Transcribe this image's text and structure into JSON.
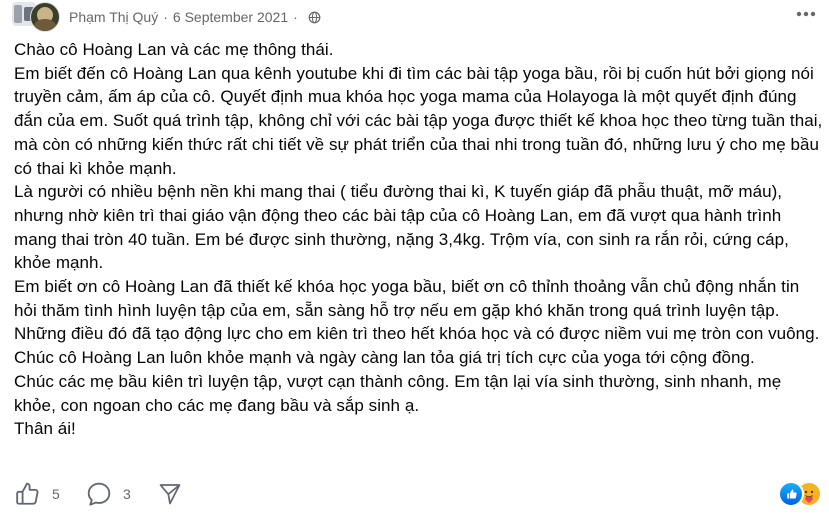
{
  "post": {
    "author": "Phạm Thị Quý",
    "separator": "·",
    "date": "6 September 2021",
    "privacy_icon": "globe-icon",
    "more_icon": "more-horizontal-icon",
    "body": [
      "Chào cô Hoàng Lan và các mẹ thông thái.",
      "Em biết đến cô Hoàng Lan qua kênh youtube khi đi tìm các bài tập yoga bầu, rồi bị cuốn hút bởi giọng nói truyền cảm, ấm áp của cô. Quyết định mua khóa học yoga mama của Holayoga là một quyết định đúng đắn của em. Suốt quá trình tập, không chỉ với các bài tập yoga được thiết kế khoa học theo từng tuần thai, mà còn có những kiến thức rất chi tiết về sự phát triển của thai nhi trong tuần đó, những lưu ý cho mẹ bầu có thai kì khỏe mạnh.",
      "Là người có nhiều bệnh nền khi mang thai ( tiểu đường thai kì, K tuyến giáp đã phẫu thuật, mỡ máu), nhưng nhờ kiên trì thai giáo vận động theo các bài tập của cô Hoàng Lan, em đã vượt qua hành trình mang thai tròn 40 tuần. Em bé được sinh thường, nặng 3,4kg. Trộm vía, con sinh ra rắn rỏi, cứng cáp, khỏe mạnh.",
      "Em biết ơn cô Hoàng Lan đã thiết kế khóa học yoga bầu, biết ơn cô thỉnh thoảng vẫn chủ động nhắn tin hỏi thăm tình hình luyện tập của em, sẵn sàng hỗ trợ nếu em gặp khó khăn trong quá trình luyện tập. Những điều đó đã tạo động lực cho em kiên trì theo hết khóa học và có được niềm vui mẹ tròn con vuông.",
      "Chúc cô Hoàng Lan luôn khỏe mạnh và ngày càng lan tỏa giá trị tích cực của yoga tới cộng đồng.",
      "Chúc các mẹ bầu kiên trì luyện tập, vượt cạn thành công. Em tận lại vía sinh thường, sinh nhanh, mẹ khỏe, con ngoan cho các mẹ đang bầu và sắp sinh ạ.",
      "Thân ái!"
    ]
  },
  "footer": {
    "like_count": "5",
    "comment_count": "3",
    "reactions": [
      "like-reaction-icon",
      "care-reaction-icon"
    ]
  },
  "colors": {
    "text": "#050505",
    "secondary_text": "#65676b",
    "like_blue": "#0866ff",
    "care_yellow": "#f7b125"
  }
}
